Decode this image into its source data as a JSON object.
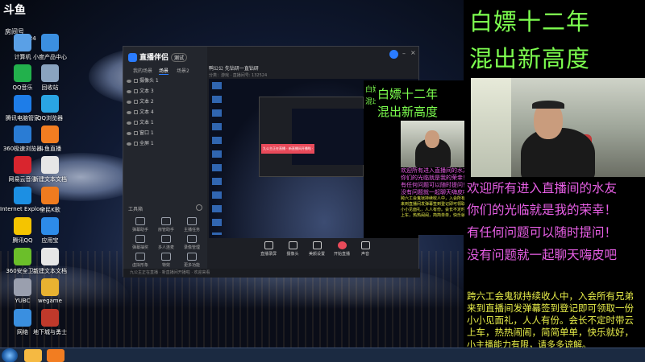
{
  "desktop": {
    "icons": [
      {
        "label": "计算机",
        "icon": "computer-icon",
        "color": "#5aa0e6"
      },
      {
        "label": "小度产品中心",
        "icon": "cloud-icon",
        "color": "#3b8fe0"
      },
      {
        "label": "QQ音乐",
        "icon": "music-icon",
        "color": "#22b14c"
      },
      {
        "label": "回收站",
        "icon": "trash-icon",
        "color": "#8aa4c0"
      },
      {
        "label": "腾讯电脑管家",
        "icon": "shield-icon",
        "color": "#1e7de8"
      },
      {
        "label": "QQ浏览器",
        "icon": "browser-icon",
        "color": "#2aa5e3"
      },
      {
        "label": "360极速浏览器",
        "icon": "browser-icon",
        "color": "#2a7cd4"
      },
      {
        "label": "斗鱼直播",
        "icon": "fish-icon",
        "color": "#f27d21"
      },
      {
        "label": "网易云音乐",
        "icon": "music-icon",
        "color": "#d9252e"
      },
      {
        "label": "新建文本文档",
        "icon": "document-icon",
        "color": "#e6e6e6"
      },
      {
        "label": "Internet Explorer",
        "icon": "ie-icon",
        "color": "#1c8fe3"
      },
      {
        "label": "全民K歌",
        "icon": "mic-icon",
        "color": "#ef7b1f"
      },
      {
        "label": "腾讯QQ",
        "icon": "qq-icon",
        "color": "#f5c400"
      },
      {
        "label": "应用宝",
        "icon": "store-icon",
        "color": "#2d8be8"
      },
      {
        "label": "360安全卫士",
        "icon": "shield-icon",
        "color": "#6bbf2a"
      },
      {
        "label": "新建文本文档",
        "icon": "document-icon",
        "color": "#e6e6e6"
      },
      {
        "label": "YUBC",
        "icon": "app-icon",
        "color": "#9a9fae"
      },
      {
        "label": "wegame",
        "icon": "game-icon",
        "color": "#e8b231"
      },
      {
        "label": "网络",
        "icon": "network-icon",
        "color": "#3a8fe0"
      },
      {
        "label": "地下城与勇士",
        "icon": "game-icon",
        "color": "#c0392b"
      }
    ],
    "watermark_top": "斗鱼",
    "watermark_room": "房间号",
    "watermark_id": "132524"
  },
  "app": {
    "name": "直播伴侣",
    "version": "测试",
    "scene_tabs": [
      "我的场景",
      "场景",
      "场景2"
    ],
    "sources": [
      "摄像头 1",
      "文本 3",
      "文本 2",
      "文本 4",
      "文本 1",
      "窗口 1",
      "全屏 1"
    ],
    "tools_title": "工具箱",
    "tools": [
      {
        "label": "弹幕助手",
        "icon": "chat-icon"
      },
      {
        "label": "房管助手",
        "icon": "user-icon"
      },
      {
        "label": "主播任务",
        "icon": "task-icon"
      },
      {
        "label": "弹幕抽奖",
        "icon": "lottery-icon"
      },
      {
        "label": "多人连麦",
        "icon": "link-icon"
      },
      {
        "label": "录像管理",
        "icon": "record-icon"
      },
      {
        "label": "虚拟形象",
        "icon": "avatar-icon"
      },
      {
        "label": "特效",
        "icon": "effect-icon"
      },
      {
        "label": "更多功能",
        "icon": "more-icon"
      }
    ],
    "header_title": "鸭公公 先钻研一直钻研",
    "header_meta": "分类：游戏 · 直播间号: 132524",
    "controls": [
      {
        "label": "直播录屏",
        "icon": "screen-icon"
      },
      {
        "label": "摄像头",
        "icon": "camera-icon"
      },
      {
        "label": "美颜设置",
        "icon": "beauty-icon"
      },
      {
        "label": "开始直播",
        "icon": "record-dot-icon"
      },
      {
        "label": "声音",
        "icon": "volume-icon"
      }
    ],
    "bottom_bar": "九公主正在直播 · 新直播间开播啦 · 欢迎来看"
  },
  "overlays": {
    "big_title": [
      "白嫖十二年",
      "混出新高度"
    ],
    "welcome": [
      "欢迎所有进入直播间的水友",
      "你们的光临就是我的荣幸！",
      "有任何问题可以随时提问！",
      "没有问题就一起聊天嗨皮吧"
    ],
    "notice": [
      "跨六工会鬼狱持续收人中，入会所有兄弟",
      "来到直播间发弹幕签到登记即可领取一份",
      "小小见面礼，人人有份。会长不定时带云",
      "上车，热热闹闹，简简单单，快乐就好，",
      "小主播能力有限，请多多谅解。"
    ],
    "small_title": [
      "白嫖十二年",
      "混出新高度"
    ]
  },
  "taskbar": {
    "items": [
      {
        "icon": "folder-icon",
        "color": "#f5b942"
      },
      {
        "icon": "app-icon",
        "color": "#f27d21"
      }
    ]
  }
}
